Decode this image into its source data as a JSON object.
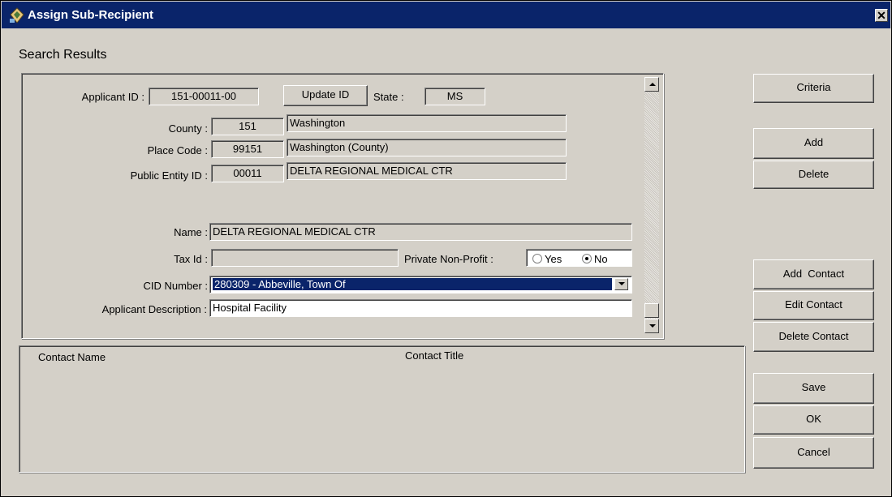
{
  "window": {
    "title": "Assign Sub-Recipient",
    "close_glyph": "✕"
  },
  "search_results_label": "Search Results",
  "form": {
    "applicant_id_label": "Applicant ID :",
    "applicant_id": "151-00011-00",
    "update_id_label": "Update ID",
    "state_label": "State :",
    "state": "MS",
    "county_label": "County :",
    "county_code": "151",
    "county_name": "Washington",
    "place_code_label": "Place Code :",
    "place_code": "99151",
    "place_name": "Washington (County)",
    "public_entity_id_label": "Public Entity ID :",
    "public_entity_id": "00011",
    "public_entity_name": "DELTA REGIONAL MEDICAL CTR",
    "name_label": "Name :",
    "name": "DELTA REGIONAL MEDICAL CTR",
    "tax_id_label": "Tax Id :",
    "tax_id": "",
    "private_non_profit_label": "Private Non-Profit :",
    "yes_label": "Yes",
    "no_label": "No",
    "private_non_profit_selected": "No",
    "cid_number_label": "CID Number :",
    "cid_number": "280309 - Abbeville, Town Of",
    "applicant_description_label": "Applicant Description :",
    "applicant_description": "Hospital Facility"
  },
  "contacts": {
    "column_name": "Contact Name",
    "column_title": "Contact Title",
    "rows": []
  },
  "buttons": {
    "criteria": "Criteria",
    "add": "Add",
    "delete": "Delete",
    "add_contact": "Add  Contact",
    "edit_contact": "Edit Contact",
    "delete_contact": "Delete Contact",
    "save": "Save",
    "ok": "OK",
    "cancel": "Cancel"
  },
  "colors": {
    "title_bar": "#0a246a",
    "dialog_bg": "#d4d0c8",
    "selection": "#0a246a"
  },
  "icons": {
    "app": "app-icon",
    "close": "close-icon",
    "scroll_up": "arrow-up-icon",
    "scroll_down": "arrow-down-icon",
    "dropdown": "chevron-down-icon"
  }
}
